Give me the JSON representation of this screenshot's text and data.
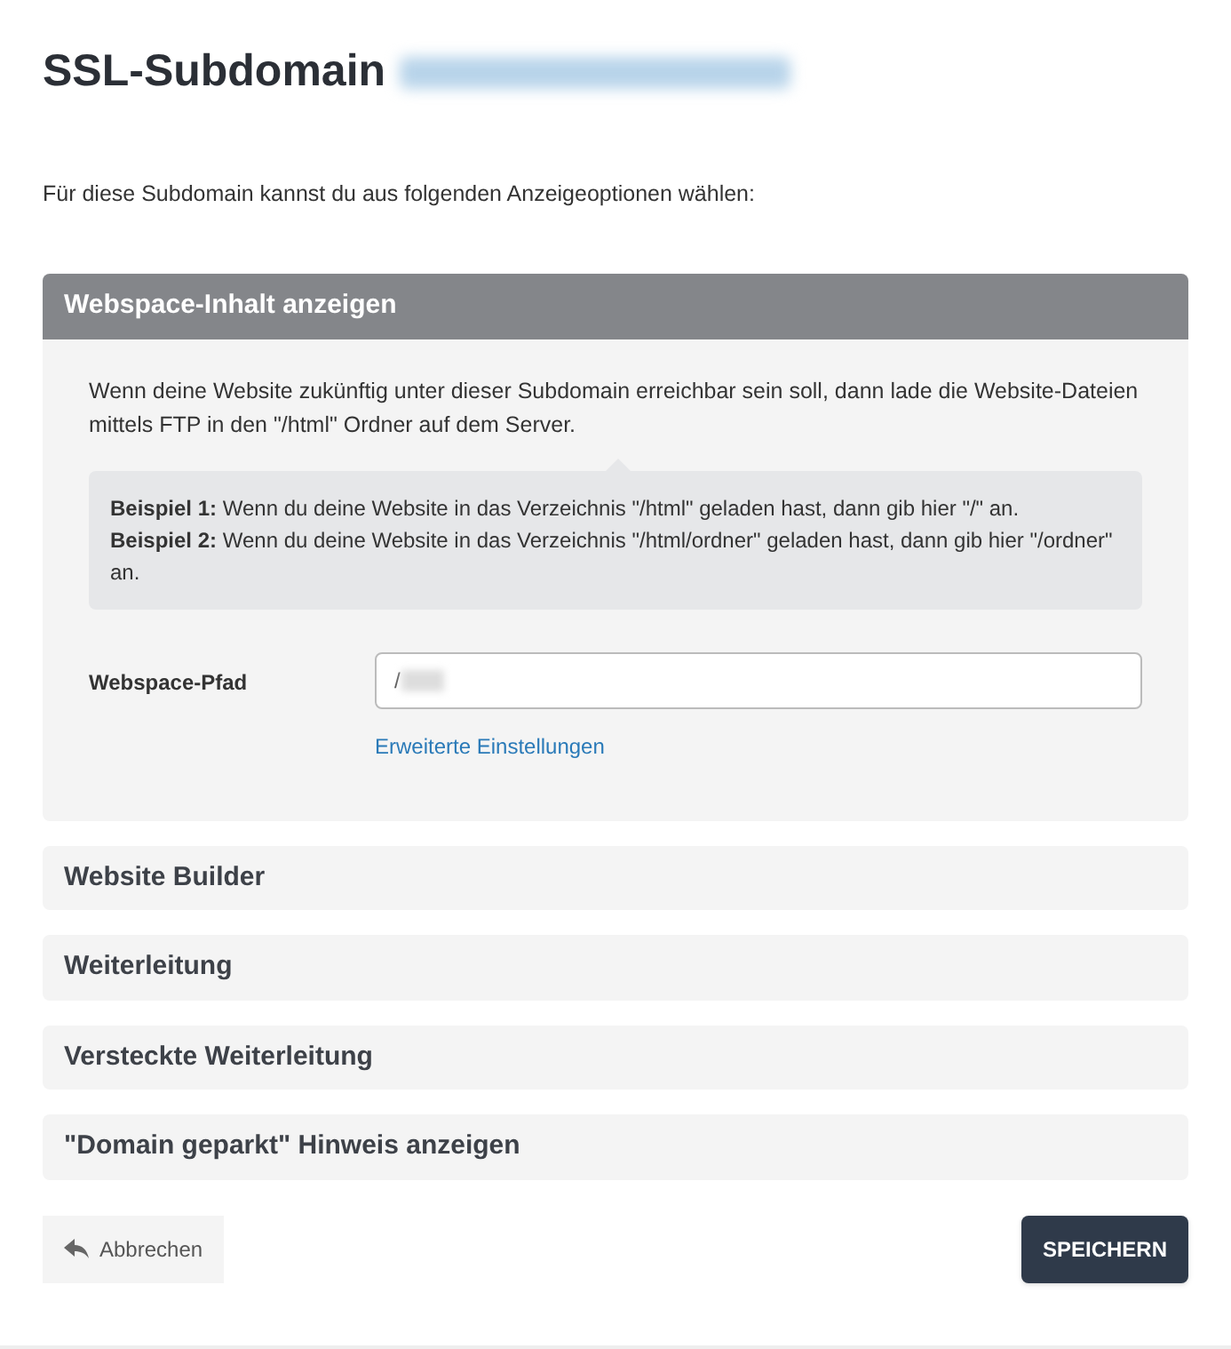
{
  "page_title": "SSL-Subdomain",
  "intro": "Für diese Subdomain kannst du aus folgenden Anzeigeoptionen wählen:",
  "sections": [
    {
      "title": "Webspace-Inhalt anzeigen",
      "expanded": true,
      "description": "Wenn deine Website zukünftig unter dieser Subdomain erreichbar sein soll, dann lade die Website-Dateien mittels FTP in den \"/html\" Ordner auf dem Server.",
      "examples": [
        "**Beispiel 1:** Wenn du deine Website in das Verzeichnis \"/html\" geladen hast, dann gib hier \"/\" an.",
        "**Beispiel 2:** Wenn du deine Website in das Verzeichnis \"/html/ordner\" geladen hast, dann gib hier \"/ordner\" an."
      ],
      "field_label": "Webspace-Pfad",
      "field_value": "/",
      "link": "Erweiterte Einstellungen"
    },
    {
      "title": "Website Builder",
      "expanded": false
    },
    {
      "title": "Weiterleitung",
      "expanded": false
    },
    {
      "title": "Versteckte Weiterleitung",
      "expanded": false
    },
    {
      "title": "\"Domain geparkt\" Hinweis anzeigen",
      "expanded": false
    }
  ],
  "cancel_button": "Abbrechen",
  "save_button": "SPEICHERN"
}
